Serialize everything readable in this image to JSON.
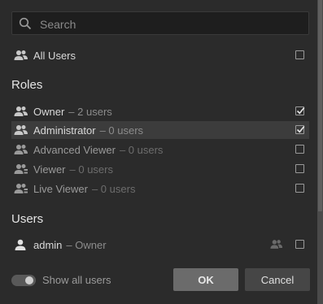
{
  "search": {
    "placeholder": "Search"
  },
  "all_users": {
    "label": "All Users",
    "checked": false
  },
  "roles": {
    "heading": "Roles",
    "items": [
      {
        "name": "Owner",
        "sub": "– 2 users",
        "checked": true,
        "selected": false,
        "dim": false,
        "icon": "users-icon"
      },
      {
        "name": "Administrator",
        "sub": "– 0 users",
        "checked": true,
        "selected": true,
        "dim": false,
        "icon": "users-icon"
      },
      {
        "name": "Advanced Viewer",
        "sub": "– 0 users",
        "checked": false,
        "selected": false,
        "dim": true,
        "icon": "users-icon"
      },
      {
        "name": "Viewer",
        "sub": "– 0 users",
        "checked": false,
        "selected": false,
        "dim": true,
        "icon": "users-view-icon"
      },
      {
        "name": "Live Viewer",
        "sub": "– 0 users",
        "checked": false,
        "selected": false,
        "dim": true,
        "icon": "users-view-icon"
      }
    ]
  },
  "users": {
    "heading": "Users",
    "items": [
      {
        "name": "admin",
        "sub": "– Owner",
        "checked": false,
        "icon": "user-icon"
      }
    ]
  },
  "footer": {
    "toggle_label": "Show all users",
    "toggle_on": false,
    "ok_label": "OK",
    "cancel_label": "Cancel"
  },
  "colors": {
    "background": "#2b2b2b",
    "selected_row": "#3c3c3c",
    "ok_button": "#6b6b6b"
  }
}
